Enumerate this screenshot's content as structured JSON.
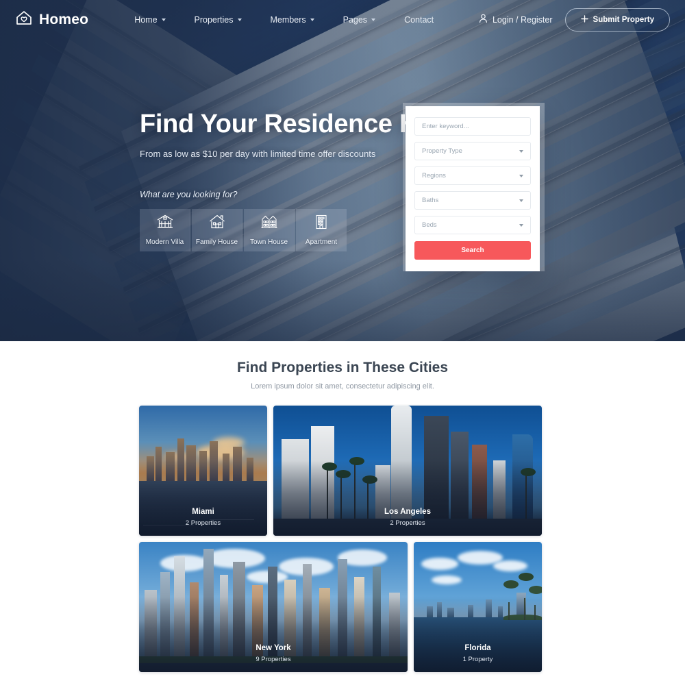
{
  "nav": {
    "logo_text": "Homeo",
    "logo_icon": "house-heart-icon",
    "links": [
      {
        "label": "Home",
        "has_caret": true
      },
      {
        "label": "Properties",
        "has_caret": true
      },
      {
        "label": "Members",
        "has_caret": true
      },
      {
        "label": "Pages",
        "has_caret": true
      },
      {
        "label": "Contact",
        "has_caret": false
      }
    ],
    "login_label": "Login / Register",
    "login_icon": "user-icon",
    "submit_label": "Submit Property",
    "submit_icon": "plus-icon"
  },
  "hero": {
    "title": "Find Your Residence Home",
    "subtitle": "From as low as $10 per day with limited time offer discounts",
    "looking_label": "What are you looking for?",
    "categories": [
      {
        "label": "Modern Villa",
        "icon": "villa-icon"
      },
      {
        "label": "Family House",
        "icon": "house-icon"
      },
      {
        "label": "Town House",
        "icon": "townhouse-icon"
      },
      {
        "label": "Apartment",
        "icon": "apartment-icon"
      }
    ]
  },
  "search": {
    "keyword_placeholder": "Enter keyword...",
    "fields": [
      {
        "label": "Property Type"
      },
      {
        "label": "Regions"
      },
      {
        "label": "Baths"
      },
      {
        "label": "Beds"
      }
    ],
    "button_label": "Search",
    "button_color": "#f7585b"
  },
  "cities_section": {
    "title": "Find Properties in These Cities",
    "subtitle": "Lorem ipsum dolor sit amet, consectetur adipiscing elit.",
    "cards": [
      {
        "name": "Miami",
        "count": "2 Properties"
      },
      {
        "name": "Los Angeles",
        "count": "2 Properties"
      },
      {
        "name": "New York",
        "count": "9 Properties"
      },
      {
        "name": "Florida",
        "count": "1 Property"
      }
    ]
  },
  "colors": {
    "navy": "#2a3c5a",
    "accent_red": "#f7585b",
    "heading": "#3b4653"
  }
}
